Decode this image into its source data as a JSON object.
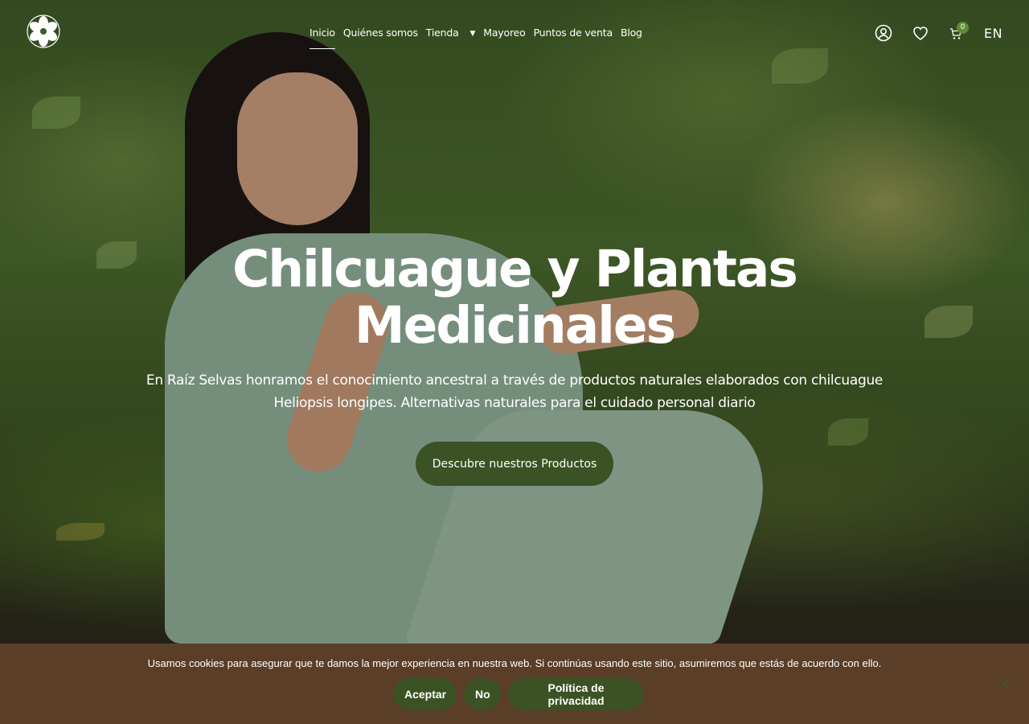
{
  "header": {
    "nav": [
      {
        "label": "Inicio",
        "active": true
      },
      {
        "label": "Quiénes somos"
      },
      {
        "label": "Tienda",
        "has_dropdown": true
      },
      {
        "label": "Mayoreo"
      },
      {
        "label": "Puntos de venta"
      },
      {
        "label": "Blog"
      }
    ],
    "icons": [
      "user-icon",
      "heart-icon",
      "cart-icon"
    ],
    "cart_count": "0",
    "language": "EN"
  },
  "hero": {
    "title_line1": "Chilcuague y Plantas",
    "title_line2": "Medicinales",
    "subtitle_line1": "En Raíz Selvas honramos el conocimiento ancestral a través de productos naturales elaborados con chilcuague",
    "subtitle_line2": "Heliopsis longipes. Alternativas naturales para el cuidado personal diario",
    "cta_label": "Descubre nuestros Productos"
  },
  "cookie": {
    "text": "Usamos cookies para asegurar que te damos la mejor experiencia en nuestra web. Si continúas usando este sitio, asumiremos que estás de acuerdo con ello.",
    "accept_label": "Aceptar",
    "no_label": "No",
    "policy_label": "Política de privacidad"
  },
  "colors": {
    "button_green": "#3b5324",
    "cookie_bg": "#5b3e27",
    "badge_green": "#5f8d34"
  }
}
